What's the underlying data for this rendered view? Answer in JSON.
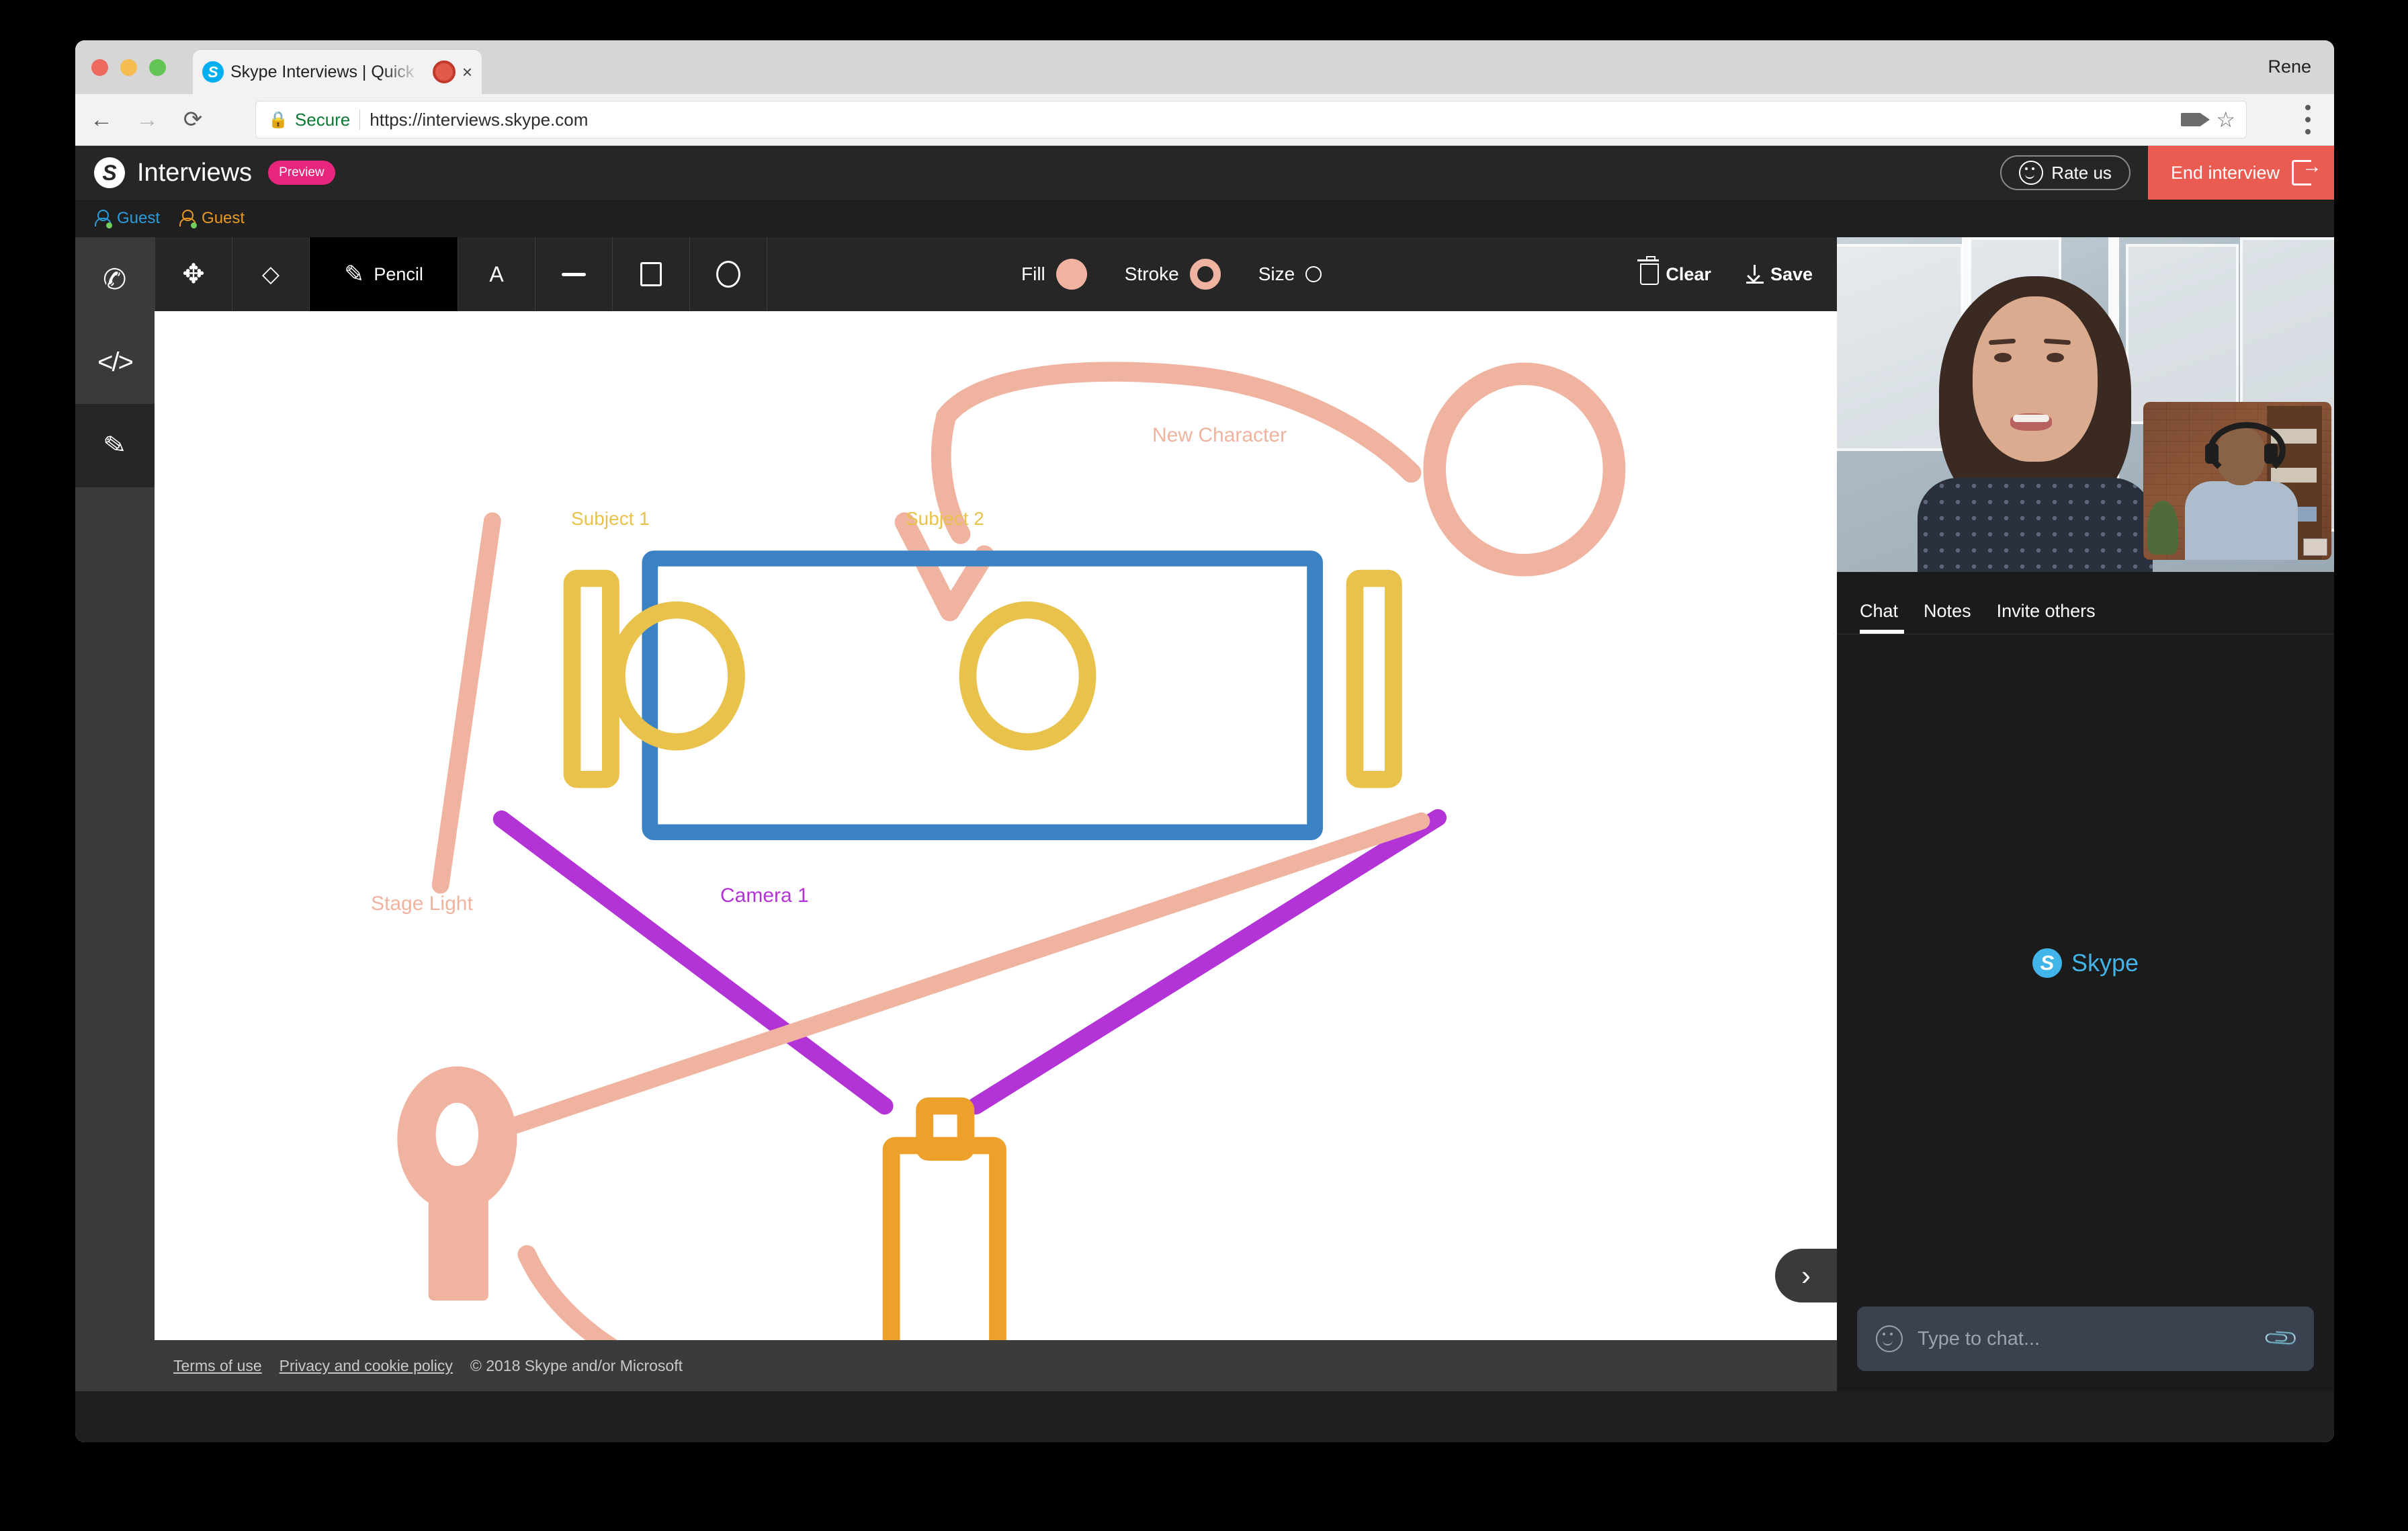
{
  "browser": {
    "tab": {
      "favicon": "skype-favicon",
      "title": "Skype Interviews | Quick an",
      "recording_indicator": "recording-dot",
      "close": "×"
    },
    "profile_name": "Rene",
    "nav": {
      "back": "←",
      "forward": "→",
      "reload": "⟳"
    },
    "omnibox": {
      "lock_icon": "lock-icon",
      "security_label": "Secure",
      "url": "https://interviews.skype.com"
    },
    "omnibox_right": {
      "camera_icon": "camera-icon",
      "star_icon": "star-icon"
    },
    "menu_icon": "kebab-menu-icon"
  },
  "app": {
    "logo_letter": "S",
    "title": "Interviews",
    "badge": "Preview",
    "rate_us": "Rate us",
    "end_interview": "End interview",
    "guests": [
      {
        "label": "Guest",
        "color": "#2d9cdb"
      },
      {
        "label": "Guest",
        "color": "#e89923"
      }
    ]
  },
  "rail": {
    "items": [
      {
        "name": "call",
        "glyph": "✆"
      },
      {
        "name": "code",
        "glyph": "</>"
      },
      {
        "name": "whiteboard",
        "glyph": "✎"
      }
    ]
  },
  "toolbar": {
    "tools": [
      {
        "name": "move",
        "glyph": "✥",
        "label": ""
      },
      {
        "name": "eraser",
        "glyph": "◇",
        "label": ""
      },
      {
        "name": "pencil",
        "glyph": "✎",
        "label": "Pencil",
        "active": true
      },
      {
        "name": "text",
        "glyph": "A",
        "label": ""
      },
      {
        "name": "line",
        "glyph": "—",
        "label": ""
      },
      {
        "name": "rectangle",
        "glyph": "▭",
        "label": ""
      },
      {
        "name": "ellipse",
        "glyph": "◯",
        "label": ""
      }
    ],
    "fill_label": "Fill",
    "fill_color": "#f0b39f",
    "stroke_label": "Stroke",
    "stroke_color": "#f0b39f",
    "size_label": "Size",
    "clear_label": "Clear",
    "save_label": "Save"
  },
  "canvas": {
    "labels": {
      "new_character": "New Character",
      "subject1": "Subject 1",
      "subject2": "Subject 2",
      "stage_light": "Stage Light",
      "camera1": "Camera 1"
    },
    "colors": {
      "salmon": "#f0b39f",
      "blue": "#3a82c4",
      "yellow": "#e8c24a",
      "orange": "#eda02a",
      "purple": "#b233d6"
    }
  },
  "footer": {
    "terms": "Terms of use",
    "privacy": "Privacy and cookie policy",
    "copyright": "© 2018 Skype and/or Microsoft"
  },
  "panel": {
    "tabs": [
      {
        "label": "Chat",
        "active": true
      },
      {
        "label": "Notes",
        "active": false
      },
      {
        "label": "Invite others",
        "active": false
      }
    ],
    "watermark_letter": "S",
    "watermark_text": "Skype",
    "chat_placeholder": "Type to chat...",
    "emoji_icon": "smiley-icon",
    "attach_icon": "paperclip-icon",
    "collapse_icon": "›"
  }
}
